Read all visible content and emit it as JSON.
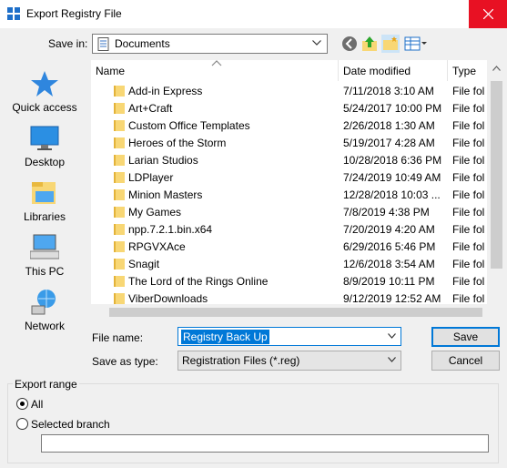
{
  "window": {
    "title": "Export Registry File"
  },
  "top": {
    "save_in_label": "Save in:",
    "save_in_value": "Documents"
  },
  "places": [
    {
      "label": "Quick access",
      "icon": "star-icon"
    },
    {
      "label": "Desktop",
      "icon": "desktop-icon"
    },
    {
      "label": "Libraries",
      "icon": "libraries-icon"
    },
    {
      "label": "This PC",
      "icon": "computer-icon"
    },
    {
      "label": "Network",
      "icon": "network-icon"
    }
  ],
  "list": {
    "columns": [
      "Name",
      "Date modified",
      "Type"
    ],
    "rows": [
      {
        "name": "Add-in Express",
        "date": "7/11/2018 3:10 AM",
        "type": "File fol"
      },
      {
        "name": "Art+Craft",
        "date": "5/24/2017 10:00 PM",
        "type": "File fol"
      },
      {
        "name": "Custom Office Templates",
        "date": "2/26/2018 1:30 AM",
        "type": "File fol"
      },
      {
        "name": "Heroes of the Storm",
        "date": "5/19/2017 4:28 AM",
        "type": "File fol"
      },
      {
        "name": "Larian Studios",
        "date": "10/28/2018 6:36 PM",
        "type": "File fol"
      },
      {
        "name": "LDPlayer",
        "date": "7/24/2019 10:49 AM",
        "type": "File fol"
      },
      {
        "name": "Minion Masters",
        "date": "12/28/2018 10:03 ...",
        "type": "File fol"
      },
      {
        "name": "My Games",
        "date": "7/8/2019 4:38 PM",
        "type": "File fol"
      },
      {
        "name": "npp.7.2.1.bin.x64",
        "date": "7/20/2019 4:20 AM",
        "type": "File fol"
      },
      {
        "name": "RPGVXAce",
        "date": "6/29/2016 5:46 PM",
        "type": "File fol"
      },
      {
        "name": "Snagit",
        "date": "12/6/2018 3:54 AM",
        "type": "File fol"
      },
      {
        "name": "The Lord of the Rings Online",
        "date": "8/9/2019 10:11 PM",
        "type": "File fol"
      },
      {
        "name": "ViberDownloads",
        "date": "9/12/2019 12:52 AM",
        "type": "File fol"
      }
    ]
  },
  "form": {
    "file_name_label": "File name:",
    "file_name_value": "Registry Back Up",
    "save_as_label": "Save as type:",
    "save_as_value": "Registration Files (*.reg)",
    "save_button": "Save",
    "cancel_button": "Cancel"
  },
  "export_range": {
    "title": "Export range",
    "all_label": "All",
    "selected_branch_label": "Selected branch",
    "selected": "All",
    "branch_value": ""
  },
  "colors": {
    "accent": "#0078d7",
    "close": "#e81123",
    "folder": "#f8d775"
  }
}
